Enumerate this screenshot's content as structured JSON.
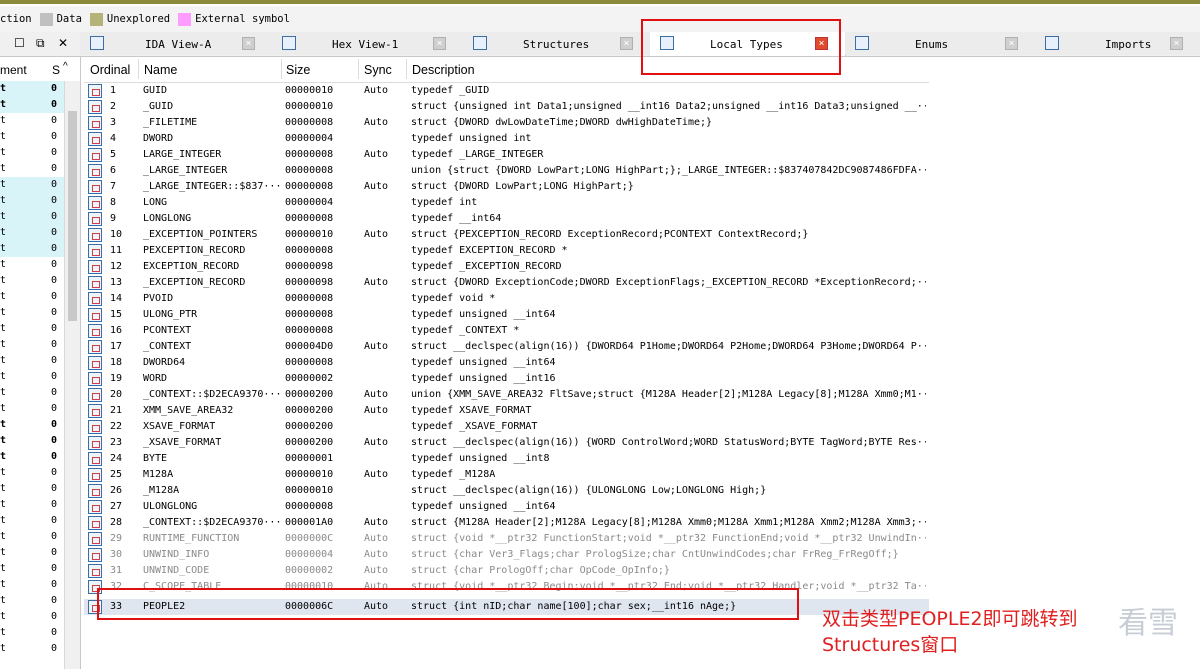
{
  "legend": [
    {
      "label": "ction",
      "color": ""
    },
    {
      "label": "Data",
      "color": "#c0c0c0"
    },
    {
      "label": "Unexplored",
      "color": "#b3b37a"
    },
    {
      "label": "External symbol",
      "color": "#ff9cff"
    }
  ],
  "left_panel": {
    "col_a": "ment",
    "col_b": "S",
    "rows": [
      {
        "a": "t",
        "b": "0"
      },
      {
        "a": "t",
        "b": "0"
      },
      {
        "a": "t",
        "b": "0"
      },
      {
        "a": "t",
        "b": "0"
      },
      {
        "a": "t",
        "b": "0"
      },
      {
        "a": "t",
        "b": "0"
      },
      {
        "a": "t",
        "b": "0"
      },
      {
        "a": "t",
        "b": "0"
      },
      {
        "a": "t",
        "b": "0"
      },
      {
        "a": "t",
        "b": "0"
      },
      {
        "a": "t",
        "b": "0"
      },
      {
        "a": "t",
        "b": "0"
      },
      {
        "a": "t",
        "b": "0"
      },
      {
        "a": "t",
        "b": "0"
      },
      {
        "a": "t",
        "b": "0"
      },
      {
        "a": "t",
        "b": "0"
      },
      {
        "a": "t",
        "b": "0"
      },
      {
        "a": "t",
        "b": "0"
      },
      {
        "a": "t",
        "b": "0"
      },
      {
        "a": "t",
        "b": "0"
      },
      {
        "a": "t",
        "b": "0"
      },
      {
        "a": "t",
        "b": "0"
      },
      {
        "a": "t",
        "b": "0"
      },
      {
        "a": "t",
        "b": "0"
      },
      {
        "a": "t",
        "b": "0"
      },
      {
        "a": "t",
        "b": "0"
      },
      {
        "a": "t",
        "b": "0"
      },
      {
        "a": "t",
        "b": "0"
      },
      {
        "a": "t",
        "b": "0"
      },
      {
        "a": "t",
        "b": "0"
      },
      {
        "a": "t",
        "b": "0"
      },
      {
        "a": "t",
        "b": "0"
      },
      {
        "a": "t",
        "b": "0"
      },
      {
        "a": "t",
        "b": "0"
      },
      {
        "a": "t",
        "b": "0"
      },
      {
        "a": "t",
        "b": "0"
      }
    ]
  },
  "tabs": [
    {
      "label": "IDA View-A",
      "icon": "ida-view-icon",
      "active": false
    },
    {
      "label": "Hex View-1",
      "icon": "hex-view-icon",
      "active": false
    },
    {
      "label": "Structures",
      "icon": "structures-icon",
      "active": false
    },
    {
      "label": "Local Types",
      "icon": "local-types-icon",
      "active": true
    },
    {
      "label": "Enums",
      "icon": "enums-icon",
      "active": false
    },
    {
      "label": "Imports",
      "icon": "imports-icon",
      "active": false
    }
  ],
  "columns": {
    "ordinal": "Ordinal",
    "name": "Name",
    "size": "Size",
    "sync": "Sync",
    "description": "Description"
  },
  "rows": [
    {
      "ord": "1",
      "name": "GUID",
      "size": "00000010",
      "sync": "Auto",
      "desc": "typedef _GUID"
    },
    {
      "ord": "2",
      "name": "_GUID",
      "size": "00000010",
      "sync": "",
      "desc": "struct {unsigned int Data1;unsigned __int16 Data2;unsigned __int16 Data3;unsigned __···"
    },
    {
      "ord": "3",
      "name": "_FILETIME",
      "size": "00000008",
      "sync": "Auto",
      "desc": "struct {DWORD dwLowDateTime;DWORD dwHighDateTime;}"
    },
    {
      "ord": "4",
      "name": "DWORD",
      "size": "00000004",
      "sync": "",
      "desc": "typedef unsigned int"
    },
    {
      "ord": "5",
      "name": "LARGE_INTEGER",
      "size": "00000008",
      "sync": "Auto",
      "desc": "typedef _LARGE_INTEGER"
    },
    {
      "ord": "6",
      "name": "_LARGE_INTEGER",
      "size": "00000008",
      "sync": "",
      "desc": "union {struct {DWORD LowPart;LONG HighPart;};_LARGE_INTEGER::$837407842DC9087486FDFA···"
    },
    {
      "ord": "7",
      "name": "_LARGE_INTEGER::$837···",
      "size": "00000008",
      "sync": "Auto",
      "desc": "struct {DWORD LowPart;LONG HighPart;}"
    },
    {
      "ord": "8",
      "name": "LONG",
      "size": "00000004",
      "sync": "",
      "desc": "typedef int"
    },
    {
      "ord": "9",
      "name": "LONGLONG",
      "size": "00000008",
      "sync": "",
      "desc": "typedef __int64"
    },
    {
      "ord": "10",
      "name": "_EXCEPTION_POINTERS",
      "size": "00000010",
      "sync": "Auto",
      "desc": "struct {PEXCEPTION_RECORD ExceptionRecord;PCONTEXT ContextRecord;}"
    },
    {
      "ord": "11",
      "name": "PEXCEPTION_RECORD",
      "size": "00000008",
      "sync": "",
      "desc": "typedef EXCEPTION_RECORD *"
    },
    {
      "ord": "12",
      "name": "EXCEPTION_RECORD",
      "size": "00000098",
      "sync": "",
      "desc": "typedef _EXCEPTION_RECORD"
    },
    {
      "ord": "13",
      "name": "_EXCEPTION_RECORD",
      "size": "00000098",
      "sync": "Auto",
      "desc": "struct {DWORD ExceptionCode;DWORD ExceptionFlags;_EXCEPTION_RECORD *ExceptionRecord;···"
    },
    {
      "ord": "14",
      "name": "PVOID",
      "size": "00000008",
      "sync": "",
      "desc": "typedef void *"
    },
    {
      "ord": "15",
      "name": "ULONG_PTR",
      "size": "00000008",
      "sync": "",
      "desc": "typedef unsigned __int64"
    },
    {
      "ord": "16",
      "name": "PCONTEXT",
      "size": "00000008",
      "sync": "",
      "desc": "typedef _CONTEXT *"
    },
    {
      "ord": "17",
      "name": "_CONTEXT",
      "size": "000004D0",
      "sync": "Auto",
      "desc": "struct __declspec(align(16)) {DWORD64 P1Home;DWORD64 P2Home;DWORD64 P3Home;DWORD64 P···"
    },
    {
      "ord": "18",
      "name": "DWORD64",
      "size": "00000008",
      "sync": "",
      "desc": "typedef unsigned __int64"
    },
    {
      "ord": "19",
      "name": "WORD",
      "size": "00000002",
      "sync": "",
      "desc": "typedef unsigned __int16"
    },
    {
      "ord": "20",
      "name": "_CONTEXT::$D2ECA9370···",
      "size": "00000200",
      "sync": "Auto",
      "desc": "union {XMM_SAVE_AREA32 FltSave;struct {M128A Header[2];M128A Legacy[8];M128A Xmm0;M1···"
    },
    {
      "ord": "21",
      "name": "XMM_SAVE_AREA32",
      "size": "00000200",
      "sync": "Auto",
      "desc": "typedef XSAVE_FORMAT"
    },
    {
      "ord": "22",
      "name": "XSAVE_FORMAT",
      "size": "00000200",
      "sync": "",
      "desc": "typedef _XSAVE_FORMAT"
    },
    {
      "ord": "23",
      "name": "_XSAVE_FORMAT",
      "size": "00000200",
      "sync": "Auto",
      "desc": "struct __declspec(align(16)) {WORD ControlWord;WORD StatusWord;BYTE TagWord;BYTE Res···"
    },
    {
      "ord": "24",
      "name": "BYTE",
      "size": "00000001",
      "sync": "",
      "desc": "typedef unsigned __int8"
    },
    {
      "ord": "25",
      "name": "M128A",
      "size": "00000010",
      "sync": "Auto",
      "desc": "typedef _M128A"
    },
    {
      "ord": "26",
      "name": "_M128A",
      "size": "00000010",
      "sync": "",
      "desc": "struct __declspec(align(16)) {ULONGLONG Low;LONGLONG High;}"
    },
    {
      "ord": "27",
      "name": "ULONGLONG",
      "size": "00000008",
      "sync": "",
      "desc": "typedef unsigned __int64"
    },
    {
      "ord": "28",
      "name": "_CONTEXT::$D2ECA9370···",
      "size": "000001A0",
      "sync": "Auto",
      "desc": "struct {M128A Header[2];M128A Legacy[8];M128A Xmm0;M128A Xmm1;M128A Xmm2;M128A Xmm3;···"
    },
    {
      "ord": "29",
      "name": "RUNTIME_FUNCTION",
      "size": "0000000C",
      "sync": "Auto",
      "desc": "struct {void *__ptr32 FunctionStart;void *__ptr32 FunctionEnd;void *__ptr32 UnwindIn···",
      "gray": true
    },
    {
      "ord": "30",
      "name": "UNWIND_INFO",
      "size": "00000004",
      "sync": "Auto",
      "desc": "struct {char Ver3_Flags;char PrologSize;char CntUnwindCodes;char FrReg_FrRegOff;}",
      "gray": true
    },
    {
      "ord": "31",
      "name": "UNWIND_CODE",
      "size": "00000002",
      "sync": "Auto",
      "desc": "struct {char PrologOff;char OpCode_OpInfo;}",
      "gray": true
    },
    {
      "ord": "32",
      "name": "C_SCOPE_TABLE",
      "size": "00000010",
      "sync": "Auto",
      "desc": "struct {void *__ptr32 Begin;void *__ptr32 End;void *__ptr32 Handler;void *__ptr32 Ta···",
      "gray": true
    },
    {
      "ord": "33",
      "name": "PEOPLE2",
      "size": "0000006C",
      "sync": "Auto",
      "desc": "struct {int nID;char name[100];char sex;__int16 nAge;}",
      "selected": true
    }
  ],
  "annotation": {
    "line1": "双击类型PEOPLE2即可跳转到",
    "line2": "Structures窗口"
  },
  "watermark": "看雪",
  "colors": {
    "highlight_box": "#e01010",
    "annotation_text": "#e02020"
  }
}
